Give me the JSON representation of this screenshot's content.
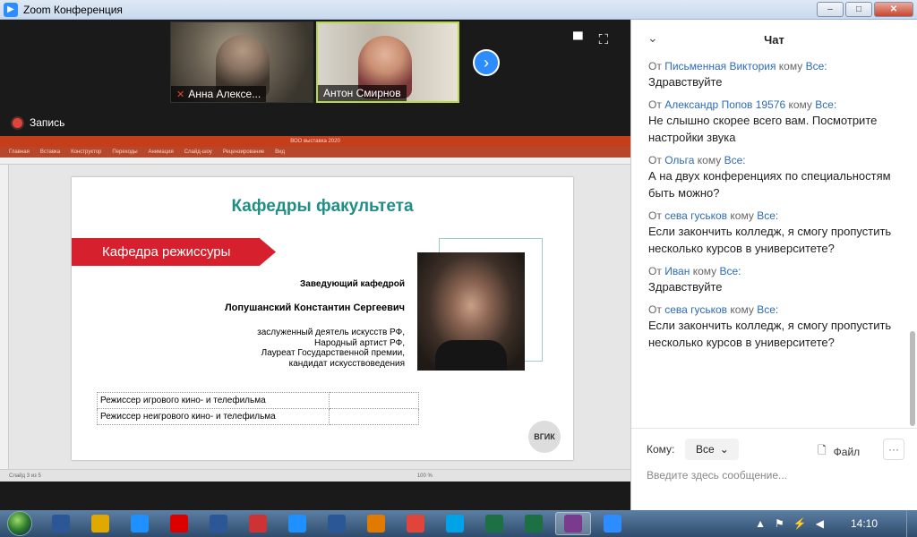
{
  "window": {
    "title": "Zoom Конференция",
    "min": "–",
    "max": "□",
    "close": "✕"
  },
  "participants": [
    {
      "name": "Анна Алексе...",
      "muted": true
    },
    {
      "name": "Антон Смирнов",
      "muted": false
    }
  ],
  "recording": {
    "label": "Запись"
  },
  "slide": {
    "window_title": "ВОО выставка 2020",
    "ribbon": [
      "Главная",
      "Вставка",
      "Конструктор",
      "Переходы",
      "Анимация",
      "Слайд-шоу",
      "Рецензирование",
      "Вид"
    ],
    "status_left": "Слайд 3 из 5",
    "status_right": "100 %",
    "title": "Кафедры факультета",
    "banner": "Кафедра режиссуры",
    "head_label": "Заведующий кафедрой",
    "head_name": "Лопушанский Константин Сергеевич",
    "desc": [
      "заслуженный деятель искусств РФ,",
      "Народный артист РФ,",
      "Лауреат Государственной премии,",
      "кандидат искусствоведения"
    ],
    "table": [
      "Режиссер игрового кино- и телефильма",
      "Режиссер неигрового кино- и телефильма"
    ]
  },
  "chat": {
    "title": "Чат",
    "from_word": "От",
    "to_word": "кому",
    "messages": [
      {
        "from": "Письменная Виктория",
        "to": "Все:",
        "text": "Здравствуйте"
      },
      {
        "from": "Александр Попов 19576",
        "to": "Все:",
        "text": "Не слышно скорее всего вам. Посмотрите настройки звука"
      },
      {
        "from": "Ольга",
        "to": "Все:",
        "text": "А на двух конференциях по специальностям быть можно?"
      },
      {
        "from": "сева гуськов",
        "to": "Все:",
        "text": "Если закончить колледж, я смогу пропустить несколько курсов в университете?"
      },
      {
        "from": "Иван",
        "to": "Все:",
        "text": "Здравствуйте"
      },
      {
        "from": "сева гуськов",
        "to": "Все:",
        "text": "Если закончить колледж, я смогу пропустить несколько курсов в университете?"
      }
    ],
    "to_label": "Кому:",
    "to_value": "Все",
    "file_label": "Файл",
    "more_label": "···",
    "input_placeholder": "Введите здесь сообщение..."
  },
  "taskbar": {
    "clock": "14:10",
    "apps": [
      "W",
      "S",
      "Y",
      "S",
      "X",
      "X",
      "W",
      "Z",
      "P"
    ]
  },
  "colors": {
    "accent": "#2d8cff",
    "banner": "#d7202d",
    "title_teal": "#1f8f86"
  }
}
